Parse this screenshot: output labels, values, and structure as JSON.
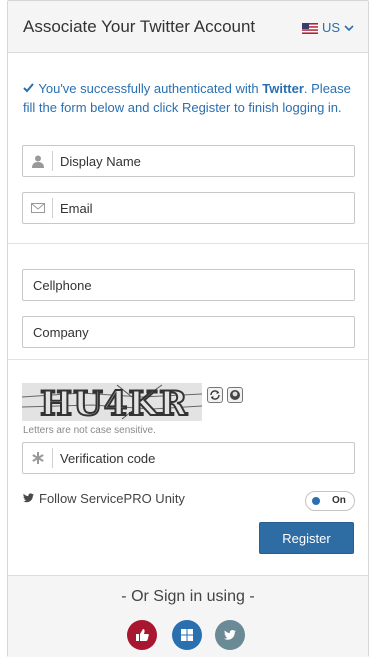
{
  "header": {
    "title": "Associate Your Twitter Account",
    "language": "US"
  },
  "message": {
    "prefix": "You've successfully authenticated with ",
    "provider": "Twitter",
    "suffix": ". Please fill the form below and click Register to finish logging in."
  },
  "fields": {
    "display_name": "Display Name",
    "email": "Email",
    "cellphone": "Cellphone",
    "company": "Company",
    "verification_code": "Verification code"
  },
  "captcha": {
    "text": "HU4KR",
    "hint": "Letters are not case sensitive."
  },
  "follow": {
    "label": "Follow ServicePRO Unity",
    "toggle_label": "On",
    "enabled": true
  },
  "register_label": "Register",
  "footer": {
    "or_text": "- Or Sign in using -",
    "providers": [
      "thumbs-up-icon",
      "windows-icon",
      "twitter-icon"
    ]
  },
  "colors": {
    "accent": "#2a6fb0",
    "register": "#2e6da4",
    "social_red": "#a8162f",
    "social_blue": "#2a6fb0",
    "social_gray": "#6a8a96"
  }
}
